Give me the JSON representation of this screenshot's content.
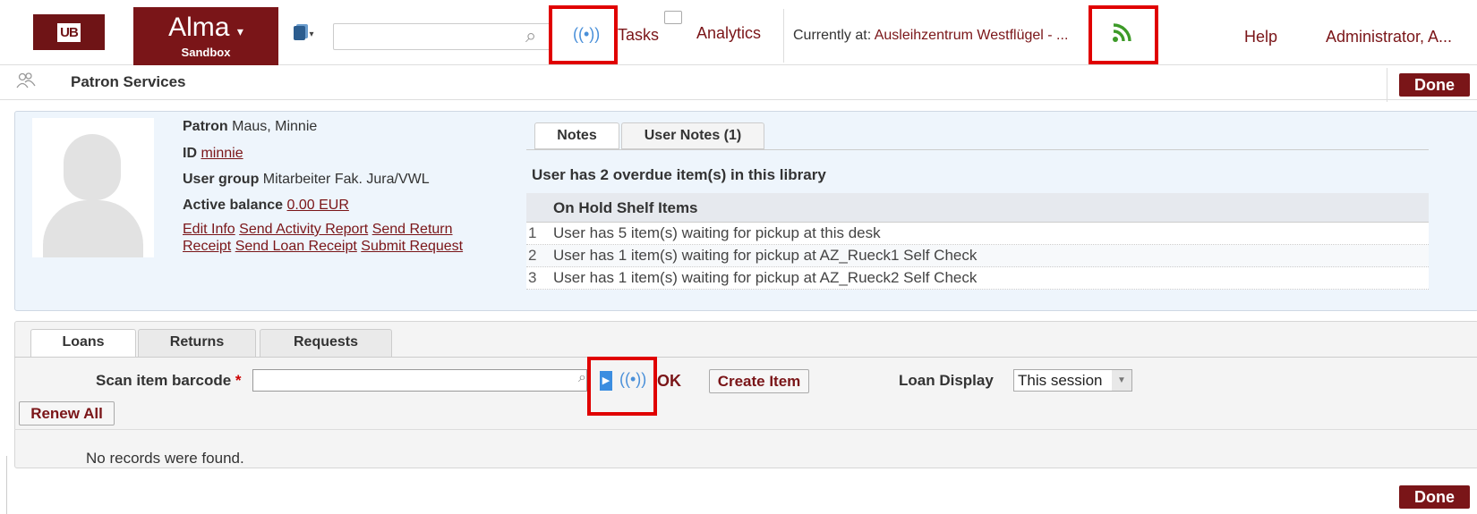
{
  "header": {
    "logo_text": "UB",
    "app_name": "Alma",
    "app_name_caret": "▾",
    "app_env": "Sandbox",
    "search_scope_icon": "catalog-icon",
    "search_placeholder": "",
    "tasks_label": "Tasks",
    "analytics_label": "Analytics",
    "currently_at_label": "Currently at:",
    "currently_at_location": "Ausleihzentrum Westflügel - ...",
    "help_label": "Help",
    "user_label": "Administrator, A..."
  },
  "page": {
    "title": "Patron Services",
    "done_label": "Done"
  },
  "patron": {
    "name_label": "Patron",
    "name_value": "Maus, Minnie",
    "id_label": "ID",
    "id_value": "minnie",
    "group_label": "User group",
    "group_value": "Mitarbeiter Fak. Jura/VWL",
    "balance_label": "Active balance",
    "balance_value": "0.00 EUR",
    "links": [
      "Edit Info",
      "Send Activity Report",
      "Send Return",
      "Receipt",
      "Send Loan Receipt",
      "Submit Request"
    ]
  },
  "notes": {
    "tabs": [
      "Notes",
      "User Notes (1)"
    ],
    "overdue_message": "User has 2 overdue item(s) in this library",
    "hold_title": "On Hold Shelf Items",
    "hold_rows": [
      {
        "num": "1",
        "text": "User has 5 item(s) waiting for pickup at this desk"
      },
      {
        "num": "2",
        "text": "User has 1 item(s) waiting for pickup at AZ_Rueck1 Self Check"
      },
      {
        "num": "3",
        "text": "User has 1 item(s) waiting for pickup at AZ_Rueck2 Self Check"
      }
    ]
  },
  "loans": {
    "tabs": [
      "Loans",
      "Returns",
      "Requests"
    ],
    "scan_label": "Scan item barcode",
    "required_mark": "*",
    "scan_value": "",
    "ok_label": "OK",
    "create_item_label": "Create Item",
    "loan_display_label": "Loan Display",
    "loan_display_value": "This session",
    "renew_all_label": "Renew All",
    "empty_message": "No records were found."
  },
  "colors": {
    "brand": "#7a1518",
    "highlight": "#e00000",
    "rss": "#3d9a28",
    "rfid": "#4a90d9"
  }
}
